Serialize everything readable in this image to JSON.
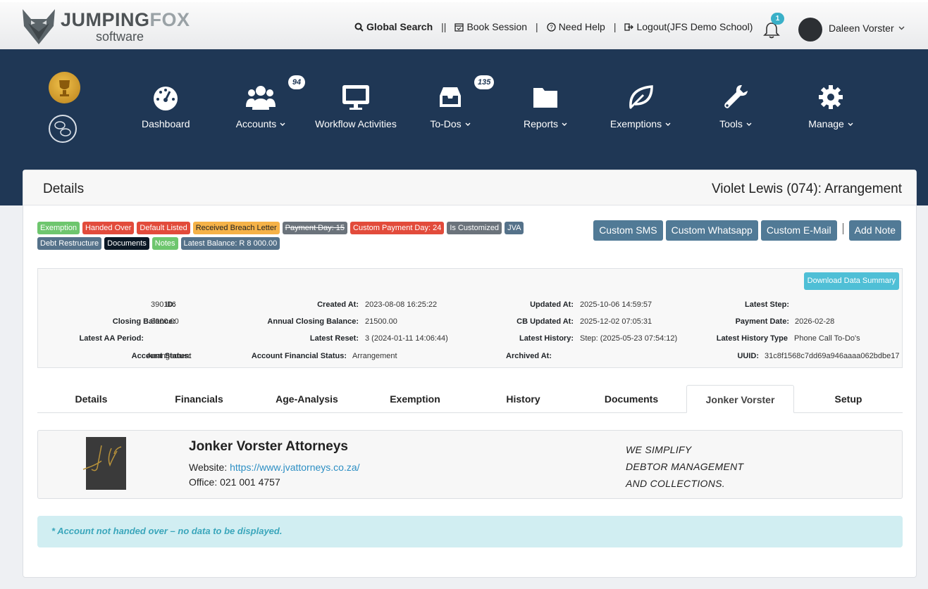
{
  "brand": {
    "name_part1": "JUMPING",
    "name_part2": "FOX",
    "subtitle": "software"
  },
  "topbar": {
    "global_search": "Global Search",
    "sep1": "||",
    "book_session": "Book Session",
    "sep2": "|",
    "need_help": "Need Help",
    "sep3": "|",
    "logout": "Logout(JFS Demo School)",
    "notification_count": "1",
    "user_name": "Daleen Vorster"
  },
  "nav": {
    "dashboard": "Dashboard",
    "accounts": "Accounts",
    "accounts_badge": "94",
    "workflow": "Workflow Activities",
    "todos": "To-Dos",
    "todos_badge": "135",
    "reports": "Reports",
    "exemptions": "Exemptions",
    "tools": "Tools",
    "manage": "Manage"
  },
  "card": {
    "title": "Details",
    "account_title": "Violet Lewis (074): Arrangement"
  },
  "badges": {
    "exemption": "Exemption",
    "handed_over": "Handed Over",
    "default_listed": "Default Listed",
    "breach_letter": "Received Breach Letter",
    "payment_day": "Payment Day: 15",
    "custom_payment_day": "Custom Payment Day: 24",
    "is_customized": "Is Customized",
    "jva": "JVA",
    "debt_restructure": "Debt Restructure",
    "documents": "Documents",
    "notes": "Notes",
    "latest_balance": "Latest Balance: R 8 000.00"
  },
  "actions": {
    "custom_sms": "Custom SMS",
    "custom_whatsapp": "Custom Whatsapp",
    "custom_email": "Custom E-Mail",
    "add_note": "Add Note"
  },
  "info": {
    "download_summary": "Download Data Summary",
    "id_label": "ID:",
    "id": "390116",
    "created_label": "Created At:",
    "created": "2023-08-08 16:25:22",
    "updated_label": "Updated At:",
    "updated": "2025-10-06 14:59:57",
    "latest_step_label": "Latest Step:",
    "latest_step": "",
    "closing_balance_label": "Closing Balance:",
    "closing_balance": "8000.00",
    "annual_closing_label": "Annual Closing Balance:",
    "annual_closing": "21500.00",
    "cb_updated_label": "CB Updated At:",
    "cb_updated": "2025-12-02 07:05:31",
    "payment_date_label": "Payment Date:",
    "payment_date": "2026-02-28",
    "latest_aa_label": "Latest AA Period:",
    "latest_aa": "",
    "latest_reset_label": "Latest Reset:",
    "latest_reset": "3 (2024-01-11 14:06:44)",
    "latest_history_label": "Latest History:",
    "latest_history": "Step: (2025-05-23 07:54:12)",
    "latest_history_type_label": "Latest History Type",
    "latest_history_type": "Phone Call To-Do's",
    "account_status_label": "Account Status:",
    "account_status": "Arrangement",
    "financial_status_label": "Account Financial Status:",
    "financial_status": "Arrangement",
    "archived_label": "Archived At:",
    "archived": "",
    "uuid_label": "UUID:",
    "uuid": "31c8f1568c7dd69a946aaaa062bdbe17"
  },
  "tabs": [
    "Details",
    "Financials",
    "Age-Analysis",
    "Exemption",
    "History",
    "Documents",
    "Jonker Vorster",
    "Setup"
  ],
  "active_tab": "Jonker Vorster",
  "jonker": {
    "title": "Jonker Vorster Attorneys",
    "website_label": "Website:",
    "website": "https://www.jvattorneys.co.za/",
    "office": "Office: 021 001 4757",
    "slogan1": "WE SIMPLIFY",
    "slogan2": "DEBTOR MANAGEMENT",
    "slogan3": "AND COLLECTIONS."
  },
  "alert": "* Account not handed over – no data to be displayed.",
  "colors": {
    "nav_bg": "#1f3755",
    "action_btn": "#517a96",
    "accent": "#4fbfd6"
  }
}
